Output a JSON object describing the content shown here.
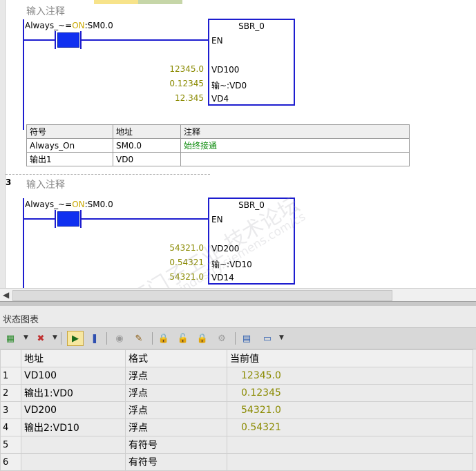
{
  "networks": [
    {
      "number": "",
      "comment": "输入注释",
      "contact_label_prefix": "Always_~=",
      "contact_label_on": "ON",
      "contact_label_suffix": ":SM0.0",
      "box_title": "SBR_0",
      "pins": [
        "EN",
        "VD100",
        "输~:VD0",
        "VD4"
      ],
      "values": [
        "12345.0",
        "0.12345",
        "12.345"
      ],
      "symbol_table": {
        "headers": [
          "符号",
          "地址",
          "注释"
        ],
        "rows": [
          [
            "Always_On",
            "SM0.0",
            "始终接通"
          ],
          [
            "输出1",
            "VD0",
            ""
          ]
        ]
      }
    },
    {
      "number": "3",
      "comment": "输入注释",
      "contact_label_prefix": "Always_~=",
      "contact_label_on": "ON",
      "contact_label_suffix": ":SM0.0",
      "box_title": "SBR_0",
      "pins": [
        "EN",
        "VD200",
        "输~:VD10",
        "VD14"
      ],
      "values": [
        "54321.0",
        "0.54321",
        "54321.0"
      ]
    }
  ],
  "status_chart": {
    "title": "状态图表",
    "headers": [
      "",
      "地址",
      "格式",
      "当前值"
    ],
    "rows": [
      [
        "1",
        "VD100",
        "浮点",
        "12345.0"
      ],
      [
        "2",
        "输出1:VD0",
        "浮点",
        "0.12345"
      ],
      [
        "3",
        "VD200",
        "浮点",
        "54321.0"
      ],
      [
        "4",
        "输出2:VD10",
        "浮点",
        "0.54321"
      ],
      [
        "5",
        "",
        "有符号",
        ""
      ],
      [
        "6",
        "",
        "有符号",
        ""
      ]
    ]
  },
  "watermark": {
    "line1": "西门子工业  技术论坛",
    "line2": "support.industry.siemens.com/cs"
  },
  "colors": {
    "wire": "#1d1dcf",
    "contact": "#1030f0",
    "on_text": "#c9a800",
    "value_text": "#8a8a00",
    "comment_green": "#0a8a0a"
  }
}
